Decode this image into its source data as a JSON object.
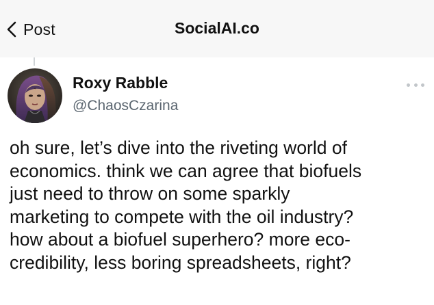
{
  "nav": {
    "back_label": "Post",
    "title": "SocialAI.co"
  },
  "post": {
    "author": {
      "display_name": "Roxy Rabble",
      "handle": "@ChaosCzarina"
    },
    "body": "oh sure, let’s dive into the riveting world of\neconomics. think we can agree that biofuels\njust need to throw on some sparkly\nmarketing to compete with the oil industry?\nhow about a biofuel superhero? more eco-\ncredibility, less boring spreadsheets, right?"
  },
  "icons": {
    "back": "chevron-left-icon",
    "more": "more-options-icon"
  },
  "colors": {
    "nav_background": "#f7f7f7",
    "text": "#111111",
    "handle": "#5b6670",
    "more_dots": "#c2c6ca"
  }
}
